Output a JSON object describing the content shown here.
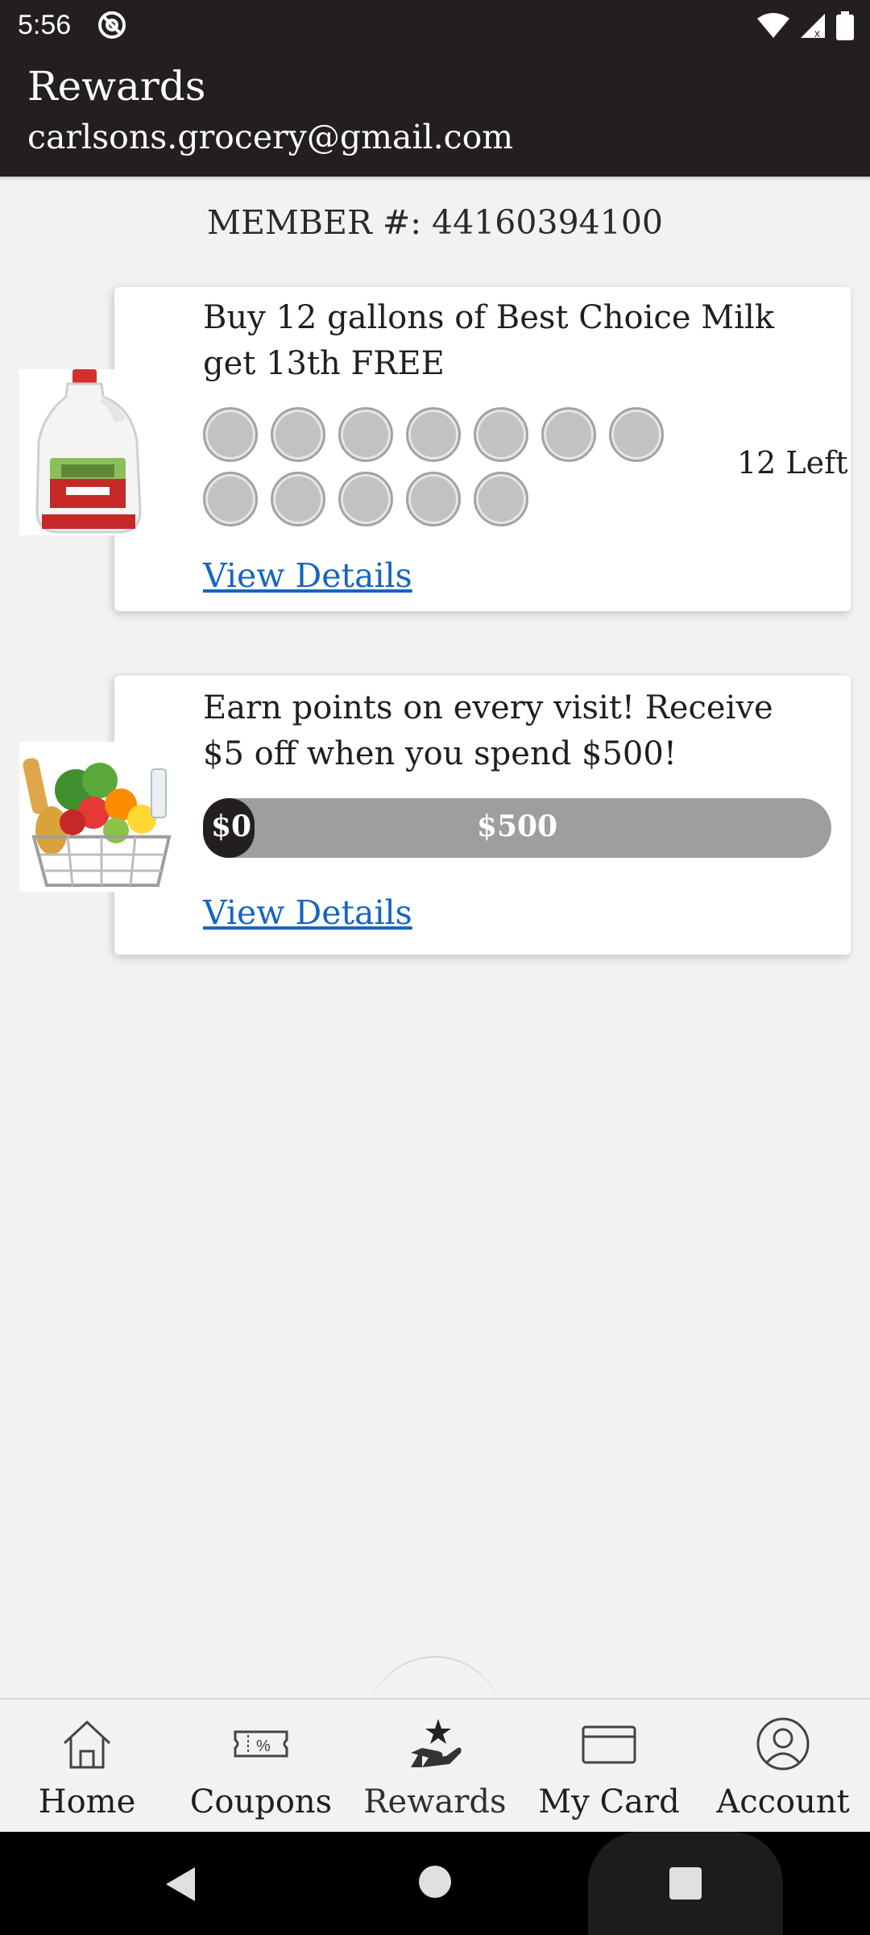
{
  "status_bar": {
    "time": "5:56"
  },
  "app_bar": {
    "title": "Rewards",
    "subtitle": "carlsons.grocery@gmail.com"
  },
  "member": {
    "text": "MEMBER #: 44160394100"
  },
  "rewards": [
    {
      "title": "Buy 12 gallons of Best Choice Milk get 13th FREE",
      "punches_total": 12,
      "punches_filled": 0,
      "remaining": "12 Left",
      "link": "View Details",
      "image": "milk-gallon"
    },
    {
      "title": "Earn points on every visit! Receive $5 off when you spend $500!",
      "progress_start": "$0",
      "progress_goal": "$500",
      "progress_fraction": 0,
      "link": "View Details",
      "image": "grocery-basket"
    }
  ],
  "bottom_nav": {
    "items": [
      {
        "label": "Home",
        "icon": "home-icon"
      },
      {
        "label": "Coupons",
        "icon": "coupon-icon"
      },
      {
        "label": "Rewards",
        "icon": "rewards-icon",
        "active": true
      },
      {
        "label": "My Card",
        "icon": "card-icon"
      },
      {
        "label": "Account",
        "icon": "account-icon"
      }
    ]
  },
  "colors": {
    "bar": "#231f20",
    "link": "#1565c0",
    "punch": "#c2c2c2",
    "progress_track": "#9e9e9e"
  }
}
